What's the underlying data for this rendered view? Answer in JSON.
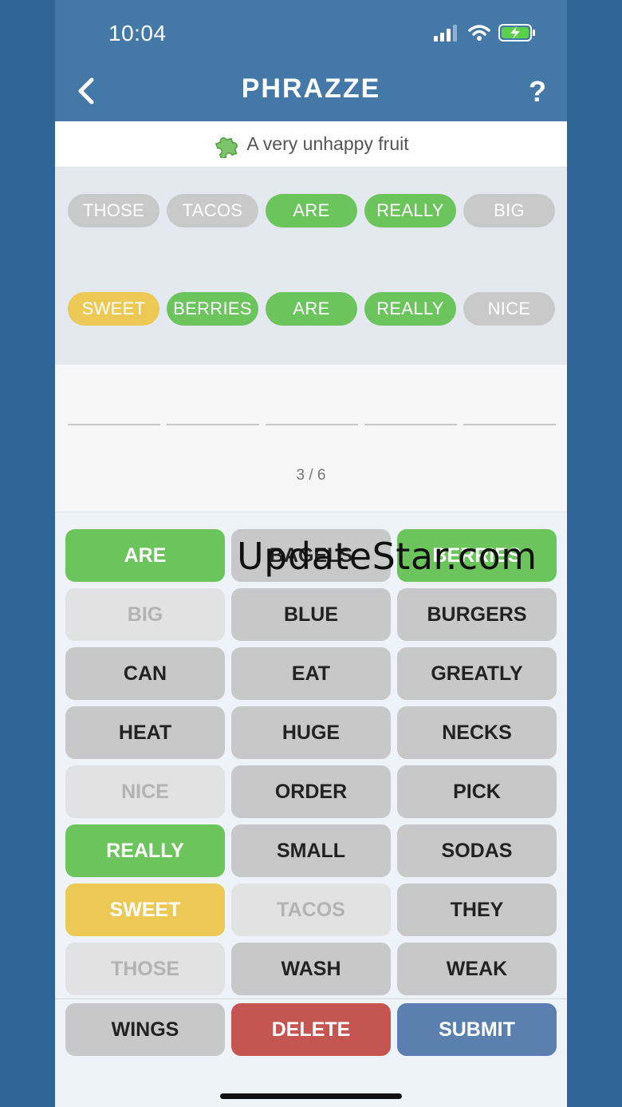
{
  "status_bar": {
    "time": "10:04"
  },
  "header": {
    "title": "PHRAZZE",
    "help": "?"
  },
  "hint": {
    "icon": "puzzle-icon",
    "text": "A very unhappy fruit"
  },
  "guesses": [
    [
      {
        "word": "THOSE",
        "state": "gray"
      },
      {
        "word": "TACOS",
        "state": "gray"
      },
      {
        "word": "ARE",
        "state": "green"
      },
      {
        "word": "REALLY",
        "state": "green"
      },
      {
        "word": "BIG",
        "state": "gray"
      }
    ],
    [
      {
        "word": "SWEET",
        "state": "yellow"
      },
      {
        "word": "BERRIES",
        "state": "green"
      },
      {
        "word": "ARE",
        "state": "green"
      },
      {
        "word": "REALLY",
        "state": "green"
      },
      {
        "word": "NICE",
        "state": "gray"
      }
    ]
  ],
  "progress": "3 / 6",
  "words": [
    {
      "word": "ARE",
      "state": "green"
    },
    {
      "word": "BAGELS",
      "state": "normal"
    },
    {
      "word": "BERRIES",
      "state": "green"
    },
    {
      "word": "BIG",
      "state": "dim"
    },
    {
      "word": "BLUE",
      "state": "normal"
    },
    {
      "word": "BURGERS",
      "state": "normal"
    },
    {
      "word": "CAN",
      "state": "normal"
    },
    {
      "word": "EAT",
      "state": "normal"
    },
    {
      "word": "GREATLY",
      "state": "normal"
    },
    {
      "word": "HEAT",
      "state": "normal"
    },
    {
      "word": "HUGE",
      "state": "normal"
    },
    {
      "word": "NECKS",
      "state": "normal"
    },
    {
      "word": "NICE",
      "state": "dim"
    },
    {
      "word": "ORDER",
      "state": "normal"
    },
    {
      "word": "PICK",
      "state": "normal"
    },
    {
      "word": "REALLY",
      "state": "green"
    },
    {
      "word": "SMALL",
      "state": "normal"
    },
    {
      "word": "SODAS",
      "state": "normal"
    },
    {
      "word": "SWEET",
      "state": "yellow"
    },
    {
      "word": "TACOS",
      "state": "dim"
    },
    {
      "word": "THEY",
      "state": "normal"
    },
    {
      "word": "THOSE",
      "state": "dim"
    },
    {
      "word": "WASH",
      "state": "normal"
    },
    {
      "word": "WEAK",
      "state": "normal"
    }
  ],
  "actions": {
    "extra_word": "WINGS",
    "delete": "DELETE",
    "submit": "SUBMIT"
  },
  "watermark": "UpdateStar.com",
  "colors": {
    "header": "#4378a7",
    "green": "#6cc45c",
    "yellow": "#ecc854",
    "gray": "#c8c8c8",
    "delete": "#c45550",
    "submit": "#5b80b0",
    "background": "#2f6496"
  }
}
